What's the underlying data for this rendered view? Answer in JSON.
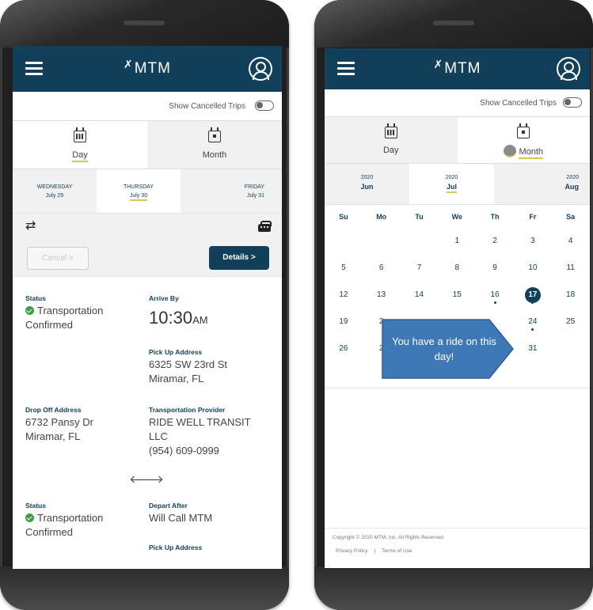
{
  "app": {
    "logo": "MTM"
  },
  "left": {
    "show_cancelled_label": "Show Cancelled Trips",
    "tabs": [
      {
        "label": "Day"
      },
      {
        "label": "Month"
      }
    ],
    "days": [
      {
        "weekday": "WEDNESDAY",
        "date": "July 29"
      },
      {
        "weekday": "THURSDAY",
        "date": "July 30"
      },
      {
        "weekday": "FRIDAY",
        "date": "July 31"
      }
    ],
    "cancel_label": "Cancel >",
    "details_label": "Details >",
    "trip1": {
      "status_label": "Status",
      "status_value_1": "Transportation",
      "status_value_2": "Confirmed",
      "arrive_label": "Arrive By",
      "arrive_time": "10:30",
      "arrive_ampm": "AM",
      "pickup_label": "Pick Up Address",
      "pickup_1": "6325 SW 23rd St",
      "pickup_2": "Miramar, FL",
      "dropoff_label": "Drop Off Address",
      "dropoff_1": "6732 Pansy Dr",
      "dropoff_2": "Miramar, FL",
      "provider_label": "Transportation Provider",
      "provider_1": "RIDE WELL TRANSIT",
      "provider_2": "LLC",
      "provider_phone": "(954) 609-0999"
    },
    "trip2": {
      "status_label": "Status",
      "status_value_1": "Transportation",
      "status_value_2": "Confirmed",
      "depart_label": "Depart After",
      "depart_value": "Will Call MTM",
      "pickup_label": "Pick Up Address"
    }
  },
  "right": {
    "show_cancelled_label": "Show Cancelled Trips",
    "tabs": [
      {
        "label": "Day"
      },
      {
        "label": "Month"
      }
    ],
    "months": [
      {
        "year": "2020",
        "month": "Jun"
      },
      {
        "year": "2020",
        "month": "Jul"
      },
      {
        "year": "2020",
        "month": "Aug"
      }
    ],
    "weekdays": [
      "Su",
      "Mo",
      "Tu",
      "We",
      "Th",
      "Fr",
      "Sa"
    ],
    "weeks": [
      [
        "",
        "",
        "",
        "1",
        "2",
        "3",
        "4"
      ],
      [
        "5",
        "6",
        "7",
        "8",
        "9",
        "10",
        "11"
      ],
      [
        "12",
        "13",
        "14",
        "15",
        "16",
        "17",
        "18"
      ],
      [
        "19",
        "2",
        "",
        "",
        "",
        "24",
        "25"
      ],
      [
        "26",
        "2",
        "",
        "",
        "0",
        "31",
        ""
      ]
    ],
    "callout_text": "You have a ride on this day!",
    "copyright": "Copyright © 2020 MTM, Inc. All Rights Reserved.",
    "privacy": "Privacy Policy",
    "separator": "|",
    "terms": "Terms of Use"
  },
  "colors": {
    "brand": "#12405a",
    "accent": "#d6c94b",
    "callout": "#3f78b7",
    "confirmed": "#3a9f47"
  },
  "icons": {
    "menu": "hamburger-icon",
    "profile": "user-circle-icon",
    "day": "calendar-grid-icon",
    "month": "calendar-dot-icon",
    "swap": "swap-arrows-icon",
    "car": "car-icon"
  }
}
